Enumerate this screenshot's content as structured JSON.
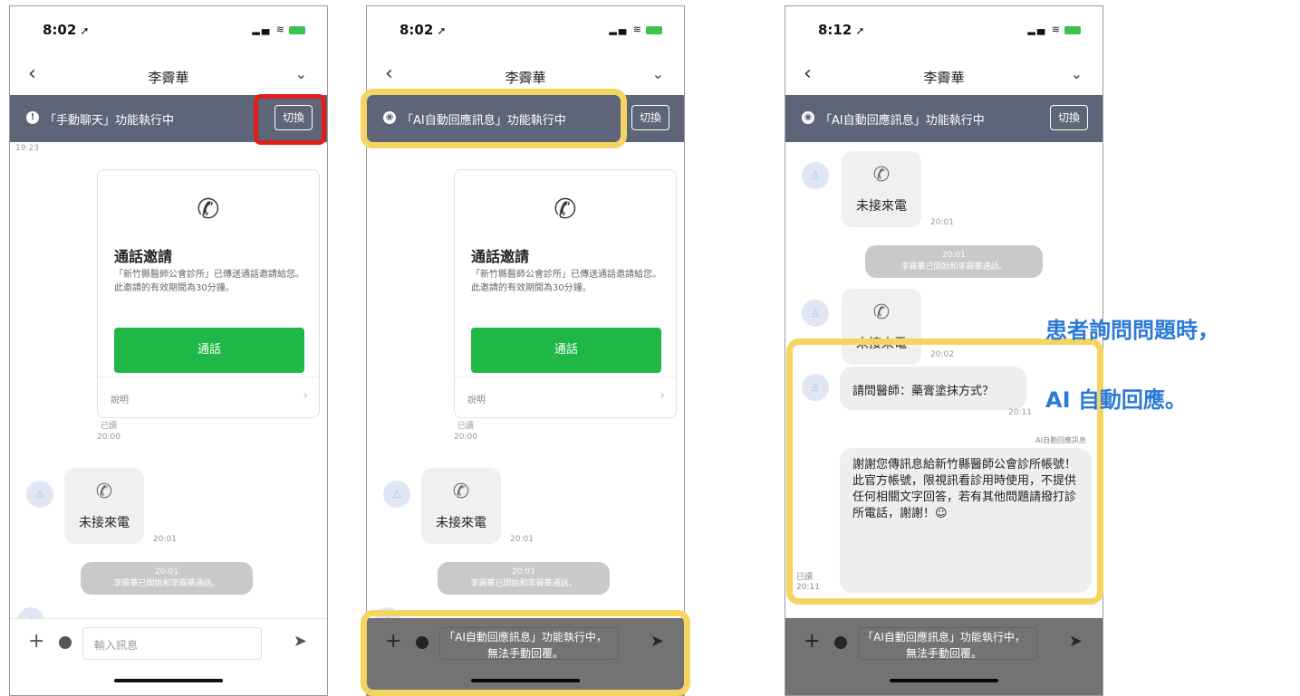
{
  "colors": {
    "banner_bg": "#5f6579",
    "call_button": "#1fb746",
    "highlight_red": "#e01e1e",
    "highlight_yellow": "#f5d561",
    "caption_blue": "#2b7ad9"
  },
  "phone1": {
    "status_time": "8:02",
    "contact_name": "李霽華",
    "banner_text": "「手動聊天」功能執行中",
    "switch_label": "切換",
    "timestamp_top": "19:23",
    "card": {
      "title": "通話邀請",
      "description": "「新竹縣醫師公會診所」已傳送通話邀請給您。此邀請的有效期間為30分鐘。",
      "call_button": "通話",
      "footer_label": "說明"
    },
    "read_label": "已讀",
    "read_time": "20:00",
    "missed_call_label": "未接來電",
    "missed_call_time": "20:01",
    "sys_time": "20:01",
    "sys_text": "李霽華已開始和李霽華通話。",
    "input_placeholder": "輸入訊息"
  },
  "phone2": {
    "status_time": "8:02",
    "contact_name": "李霽華",
    "banner_text": "「AI自動回應訊息」功能執行中",
    "switch_label": "切換",
    "card": {
      "title": "通話邀請",
      "description": "「新竹縣醫師公會診所」已傳送通話邀請給您。此邀請的有效期間為30分鐘。",
      "call_button": "通話",
      "footer_label": "說明"
    },
    "read_label": "已讀",
    "read_time": "20:00",
    "missed_call_label": "未接來電",
    "missed_call_time": "20:01",
    "sys_time": "20:01",
    "sys_text": "李霽華已開始和李霽華通話。",
    "overlay_line1": "「AI自動回應訊息」功能執行中，",
    "overlay_line2": "無法手動回覆。"
  },
  "phone3": {
    "status_time": "8:12",
    "contact_name": "李霽華",
    "banner_text": "「AI自動回應訊息」功能執行中",
    "switch_label": "切換",
    "missed_call_label": "未接來電",
    "missed_call_time1": "20:01",
    "missed_call_time2": "20:02",
    "sys_time": "20:01",
    "sys_text": "李霽華已開始和李霽華通話。",
    "question": "請問醫師：藥膏塗抹方式？",
    "question_time": "20:11",
    "ai_tag": "AI自動回應訊息",
    "ai_reply": "謝謝您傳訊息給新竹縣醫師公會診所帳號！此官方帳號，限視訊看診用時使用，不提供任何相關文字回答，若有其他問題請撥打診所電話，謝謝！☺",
    "read_label": "已讀",
    "read_time": "20:11",
    "overlay_line1": "「AI自動回應訊息」功能執行中，",
    "overlay_line2": "無法手動回覆。"
  },
  "caption": {
    "line1": "患者詢問問題時，",
    "line2": "AI 自動回應。"
  }
}
